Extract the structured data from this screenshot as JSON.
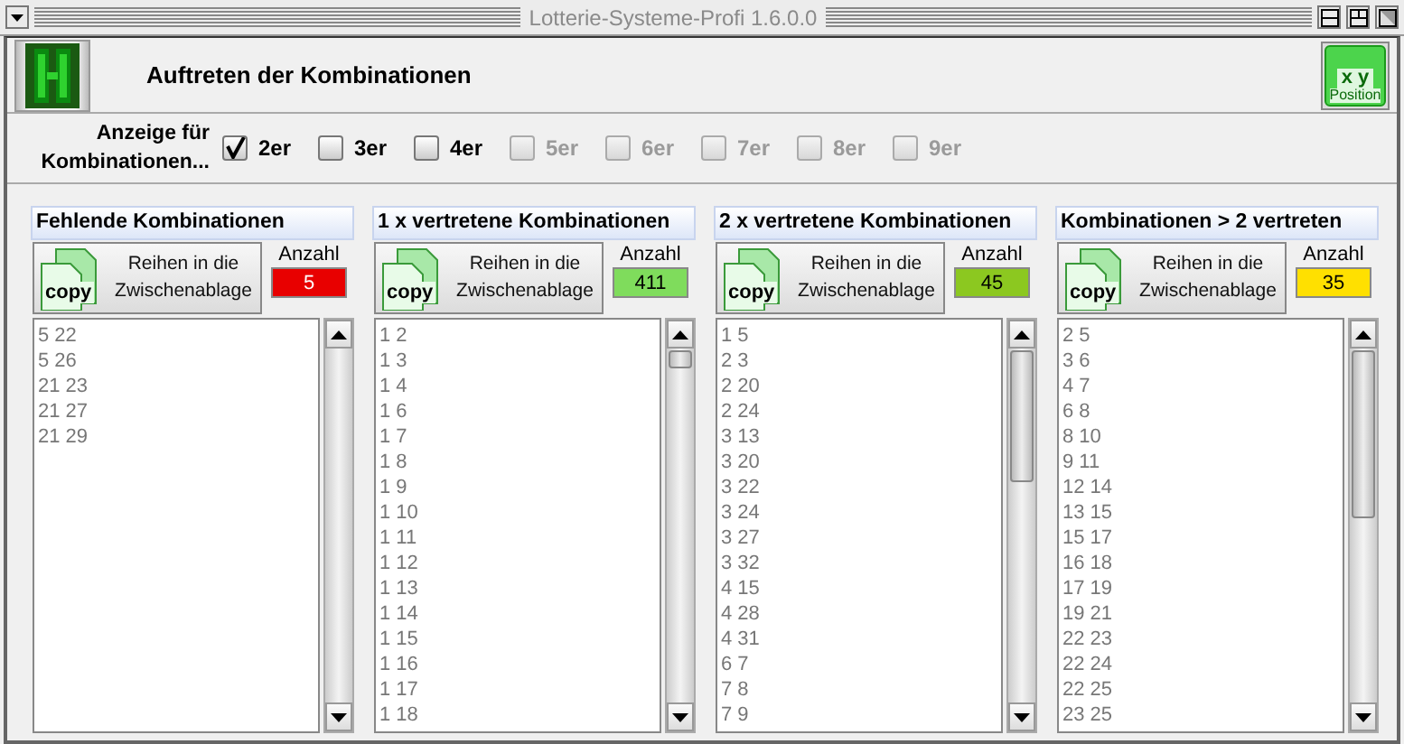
{
  "window": {
    "title": "Lotterie-Systeme-Profi 1.6.0.0"
  },
  "header": {
    "title": "Auftreten der Kombinationen",
    "position_button": {
      "icon_text": "x y",
      "label": "Position"
    }
  },
  "filter": {
    "label": "Anzeige für\nKombinationen...",
    "options": [
      {
        "label": "2er",
        "checked": true,
        "disabled": false
      },
      {
        "label": "3er",
        "checked": false,
        "disabled": false
      },
      {
        "label": "4er",
        "checked": false,
        "disabled": false
      },
      {
        "label": "5er",
        "checked": false,
        "disabled": true
      },
      {
        "label": "6er",
        "checked": false,
        "disabled": true
      },
      {
        "label": "7er",
        "checked": false,
        "disabled": true
      },
      {
        "label": "8er",
        "checked": false,
        "disabled": true
      },
      {
        "label": "9er",
        "checked": false,
        "disabled": true
      }
    ]
  },
  "panels": [
    {
      "title": "Fehlende Kombinationen",
      "copy_button": {
        "icon_text": "copy",
        "label": "Reihen in die Zwischenablage"
      },
      "count_label": "Anzahl",
      "count": "5",
      "color": "#e80000",
      "rows": [
        "5 22",
        "5 26",
        "21 23",
        "21 27",
        "21 29"
      ]
    },
    {
      "title": "1 x vertretene Kombinationen",
      "copy_button": {
        "icon_text": "copy",
        "label": "Reihen in die Zwischenablage"
      },
      "count_label": "Anzahl",
      "count": "411",
      "color": "#7fdc5c",
      "rows": [
        "1 2",
        "1 3",
        "1 4",
        "1 6",
        "1 7",
        "1 8",
        "1 9",
        "1 10",
        "1 11",
        "1 12",
        "1 13",
        "1 14",
        "1 15",
        "1 16",
        "1 17",
        "1 18"
      ]
    },
    {
      "title": "2 x vertretene Kombinationen",
      "copy_button": {
        "icon_text": "copy",
        "label": "Reihen in die Zwischenablage"
      },
      "count_label": "Anzahl",
      "count": "45",
      "color": "#8cc820",
      "rows": [
        "1 5",
        "2 3",
        "2 20",
        "2 24",
        "3 13",
        "3 20",
        "3 22",
        "3 24",
        "3 27",
        "3 32",
        "4 15",
        "4 28",
        "4 31",
        "6 7",
        "7 8",
        "7 9"
      ]
    },
    {
      "title": "Kombinationen > 2 vertreten",
      "copy_button": {
        "icon_text": "copy",
        "label": "Reihen in die Zwischenablage"
      },
      "count_label": "Anzahl",
      "count": "35",
      "color": "#ffe000",
      "rows": [
        "2 5",
        "3 6",
        "4 7",
        "6 8",
        "8 10",
        "9 11",
        "12 14",
        "13 15",
        "15 17",
        "16 18",
        "17 19",
        "19 21",
        "22 23",
        "22 24",
        "22 25",
        "23 25"
      ]
    }
  ]
}
